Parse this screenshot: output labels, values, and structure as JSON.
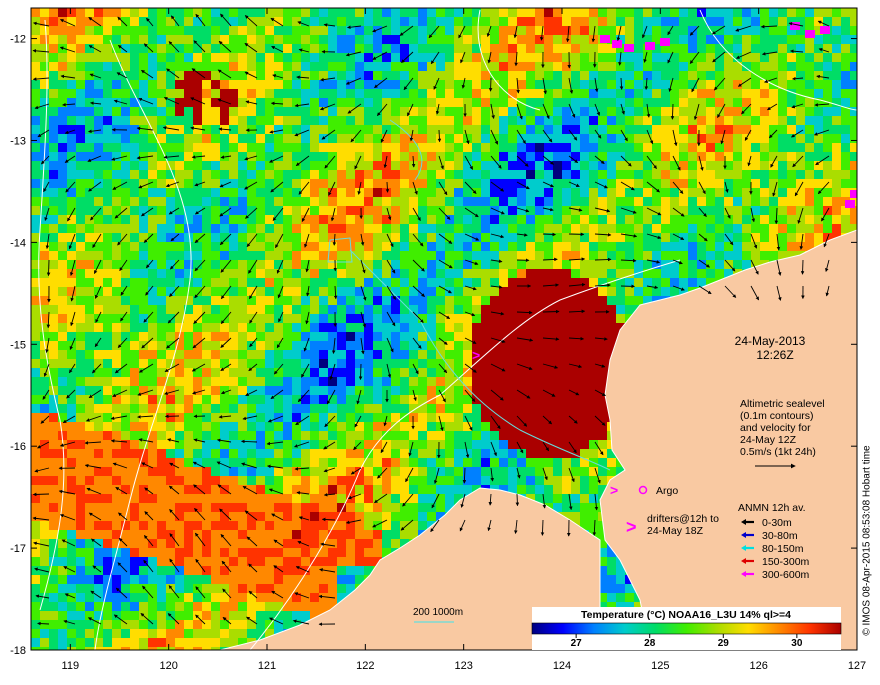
{
  "map": {
    "lat_ticks": [
      "-12",
      "-13",
      "-14",
      "-15",
      "-16",
      "-17",
      "-18"
    ],
    "lon_ticks": [
      "119",
      "120",
      "121",
      "122",
      "123",
      "124",
      "125",
      "126",
      "127"
    ],
    "extent": {
      "lon_min": 118.6,
      "lon_max": 127.0,
      "lat_min": -18.0,
      "lat_max": -11.7
    }
  },
  "datetime": {
    "date": "24-May-2013",
    "time": "12:26Z"
  },
  "altimetry_note": {
    "line1": "Altimetric sealevel",
    "line2": "(0.1m contours)",
    "line3": "and velocity for",
    "line4": "24-May 12Z",
    "line5": "0.5m/s (1kt 24h)"
  },
  "argo": {
    "label": "Argo",
    "color": "#ff00ff"
  },
  "drifters": {
    "line1": "drifters@12h to",
    "line2": "24-May 18Z",
    "color": "#ff00ff"
  },
  "anmn": {
    "title": "ANMN 12h av.",
    "items": [
      {
        "label": "0-30m",
        "color": "#000000"
      },
      {
        "label": "30-80m",
        "color": "#0000cc"
      },
      {
        "label": "80-150m",
        "color": "#00e0e0"
      },
      {
        "label": "150-300m",
        "color": "#dd0000"
      },
      {
        "label": "300-600m",
        "color": "#ff00ff"
      }
    ]
  },
  "isobath": {
    "label": "200  1000m",
    "color": "#66dddd"
  },
  "colorbar": {
    "title": "Temperature (°C) NOAA16_L3U 14% ql>=4",
    "ticks": [
      "27",
      "28",
      "29",
      "30"
    ],
    "colors": [
      "#00007f",
      "#0000ff",
      "#0080ff",
      "#00cccc",
      "#00dd66",
      "#40ee00",
      "#aadd00",
      "#ffdd00",
      "#ff8800",
      "#ff3300",
      "#aa0000"
    ]
  },
  "credit": "© IMOS 08-Apr-2015 08:53:08 Hobart time",
  "colors": {
    "land": "#f9c9a2",
    "hot": "#9e0000",
    "frame": "#000000"
  }
}
